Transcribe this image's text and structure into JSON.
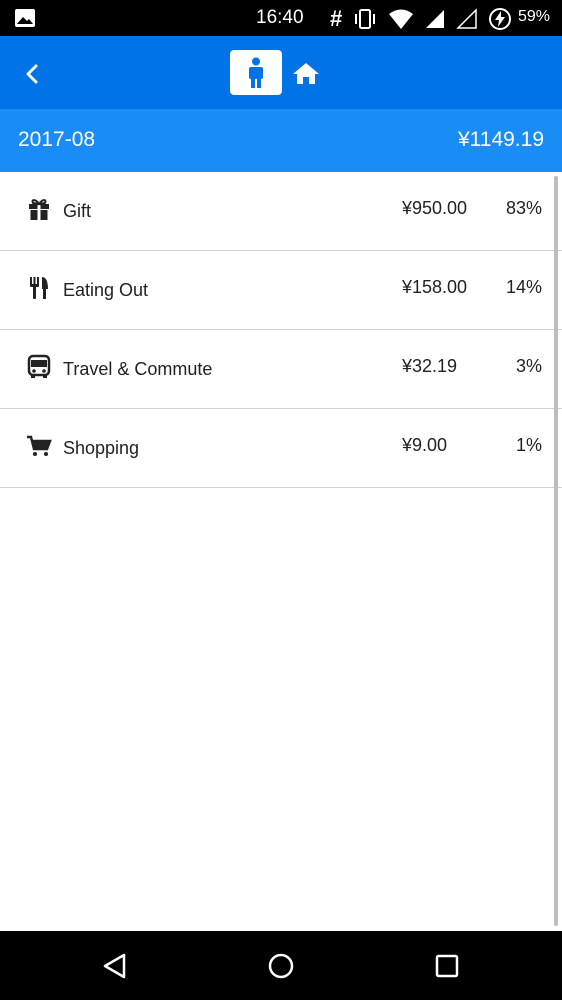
{
  "status_bar": {
    "time": "16:40",
    "battery": "59%",
    "icons": [
      "image-icon",
      "hash-icon",
      "vibrate-icon",
      "wifi-icon",
      "signal-icon",
      "signal-empty-icon",
      "battery-charging-icon"
    ]
  },
  "header": {
    "back_icon": "chevron-left-icon",
    "segments": [
      {
        "icon": "person-icon",
        "selected": true
      },
      {
        "icon": "home-icon",
        "selected": false
      }
    ],
    "accent": "#0073e6"
  },
  "summary": {
    "period": "2017-08",
    "total": "¥1149.19",
    "background": "#1a8cf5"
  },
  "categories": [
    {
      "name": "Gift",
      "amount": "¥950.00",
      "percent": "83%",
      "icon": "gift-icon"
    },
    {
      "name": "Eating Out",
      "amount": "¥158.00",
      "percent": "14%",
      "icon": "utensils-icon"
    },
    {
      "name": "Travel & Commute",
      "amount": "¥32.19",
      "percent": "3%",
      "icon": "bus-icon"
    },
    {
      "name": "Shopping",
      "amount": "¥9.00",
      "percent": "1%",
      "icon": "cart-icon"
    }
  ],
  "nav_bar": {
    "buttons": [
      "back-triangle-icon",
      "home-circle-icon",
      "recents-square-icon"
    ]
  }
}
